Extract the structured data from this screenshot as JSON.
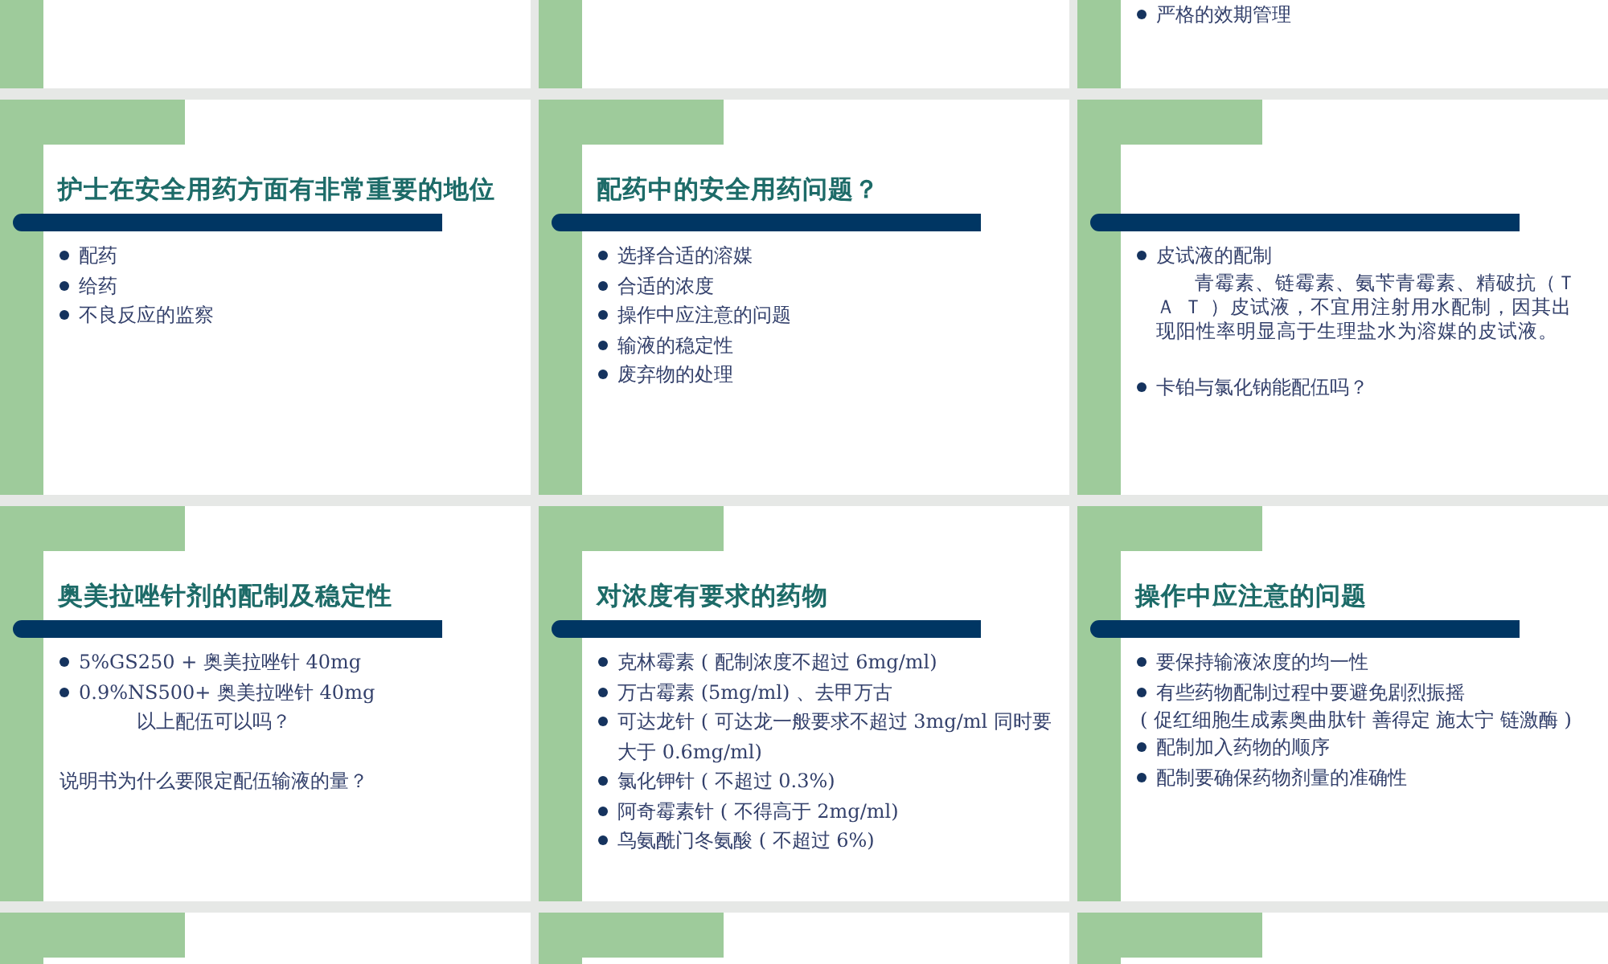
{
  "slides": [
    {
      "kind": "cut_top"
    },
    {
      "kind": "cut_top"
    },
    {
      "kind": "cut_top",
      "items": [
        {
          "kind": "bullet",
          "text": "严格的效期管理"
        }
      ]
    },
    {
      "kind": "full",
      "title": "护士在安全用药方面有非常重要的地位",
      "items": [
        {
          "kind": "bullet",
          "text": "配药"
        },
        {
          "kind": "bullet",
          "text": "给药"
        },
        {
          "kind": "bullet",
          "text": "不良反应的监察"
        }
      ]
    },
    {
      "kind": "full",
      "title": "配药中的安全用药问题？",
      "items": [
        {
          "kind": "bullet",
          "text": "选择合适的溶媒"
        },
        {
          "kind": "bullet",
          "text": "合适的浓度"
        },
        {
          "kind": "bullet",
          "text": "操作中应注意的问题"
        },
        {
          "kind": "bullet",
          "text": "输液的稳定性"
        },
        {
          "kind": "bullet",
          "text": "废弃物的处理"
        }
      ]
    },
    {
      "kind": "full",
      "items": [
        {
          "kind": "bullet",
          "text": "皮试液的配制"
        },
        {
          "kind": "paragraph",
          "text": "青霉素、链霉素、氨苄青霉素、精破抗（ＴＡ Ｔ ）皮试液，不宜用注射用水配制，因其出现阳性率明显高于生理盐水为溶媒的皮试液。"
        },
        {
          "kind": "bullet",
          "text": "卡铂与氯化钠能配伍吗？"
        }
      ]
    },
    {
      "kind": "full",
      "title": "奥美拉唑针剂的配制及稳定性",
      "items": [
        {
          "kind": "bullet",
          "text": "5%GS250 + 奥美拉唑针 40mg"
        },
        {
          "kind": "bullet",
          "text": "0.9%NS500+ 奥美拉唑针 40mg"
        },
        {
          "kind": "centered",
          "text": "以上配伍可以吗？"
        },
        {
          "kind": "flush",
          "text": "说明书为什么要限定配伍输液的量？"
        }
      ]
    },
    {
      "kind": "full",
      "title": "对浓度有要求的药物",
      "items": [
        {
          "kind": "bullet",
          "text": "克林霉素 ( 配制浓度不超过 6mg/ml)"
        },
        {
          "kind": "bullet",
          "text": "万古霉素 (5mg/ml) 、去甲万古"
        },
        {
          "kind": "bullet",
          "text": "可达龙针 ( 可达龙一般要求不超过 3mg/ml  同时要大于 0.6mg/ml)"
        },
        {
          "kind": "bullet",
          "text": "氯化钾针 ( 不超过 0.3%)"
        },
        {
          "kind": "bullet",
          "text": "阿奇霉素针 ( 不得高于 2mg/ml)"
        },
        {
          "kind": "bullet",
          "text": "鸟氨酰门冬氨酸 ( 不超过 6%)"
        }
      ]
    },
    {
      "kind": "full",
      "title": "操作中应注意的问题",
      "items": [
        {
          "kind": "bullet",
          "text": "要保持输液浓度的均一性"
        },
        {
          "kind": "bullet",
          "text": "有些药物配制过程中要避免剧烈振摇"
        },
        {
          "kind": "aside",
          "text": "( 促红细胞生成素奥曲肽针  善得定  施太宁  链激酶 )"
        },
        {
          "kind": "bullet",
          "text": "配制加入药物的顺序"
        },
        {
          "kind": "bullet",
          "text": "配制要确保药物剂量的准确性"
        }
      ]
    },
    {
      "kind": "cut_bottom"
    },
    {
      "kind": "cut_bottom"
    },
    {
      "kind": "cut_bottom"
    }
  ]
}
